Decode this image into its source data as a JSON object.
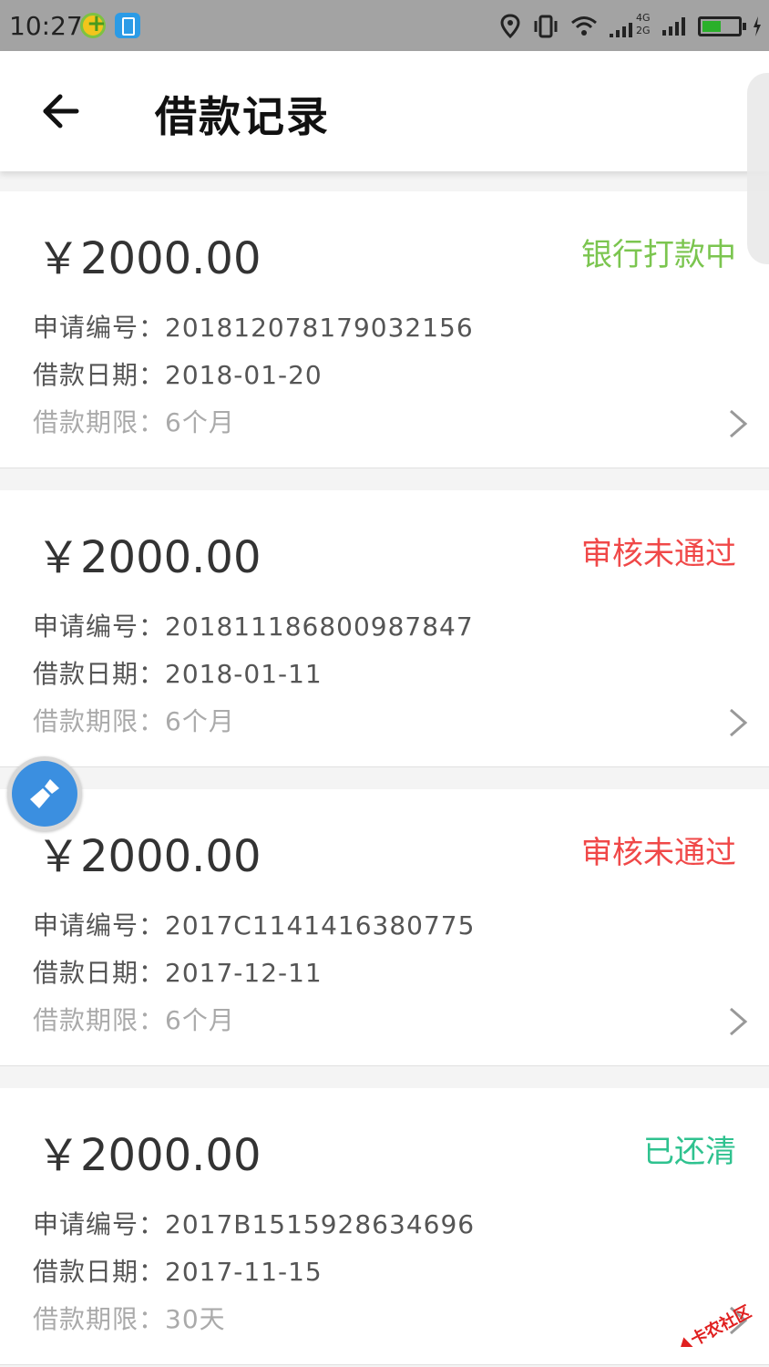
{
  "status_bar": {
    "time": "10:27",
    "network_4g": "4G",
    "network_2g": "2G",
    "icons": [
      "app-icon-green-plus",
      "app-icon-blue-battery",
      "location-icon",
      "vibrate-icon",
      "wifi-icon",
      "signal-icon",
      "signal-icon",
      "battery-icon"
    ]
  },
  "header": {
    "title": "借款记录",
    "back_icon": "arrow-left-icon"
  },
  "labels": {
    "application_no": "申请编号：",
    "loan_date": "借款日期：",
    "loan_term": "借款期限："
  },
  "loans": [
    {
      "amount": "￥2000.00",
      "status": "银行打款中",
      "status_color": "#7bc54f",
      "application_no": "201812078179032156",
      "loan_date": "2018-01-20",
      "loan_term": "6个月"
    },
    {
      "amount": "￥2000.00",
      "status": "审核未通过",
      "status_color": "#f04848",
      "application_no": "201811186800987847",
      "loan_date": "2018-01-11",
      "loan_term": "6个月"
    },
    {
      "amount": "￥2000.00",
      "status": "审核未通过",
      "status_color": "#f04848",
      "application_no": "2017C1141416380775",
      "loan_date": "2017-12-11",
      "loan_term": "6个月"
    },
    {
      "amount": "￥2000.00",
      "status": "已还清",
      "status_color": "#2fc28f",
      "application_no": "2017B1515928634696",
      "loan_date": "2017-11-15",
      "loan_term": "30天"
    }
  ],
  "watermark": {
    "text": "卡农社区"
  },
  "float_ball": {
    "icon": "broom-icon"
  }
}
